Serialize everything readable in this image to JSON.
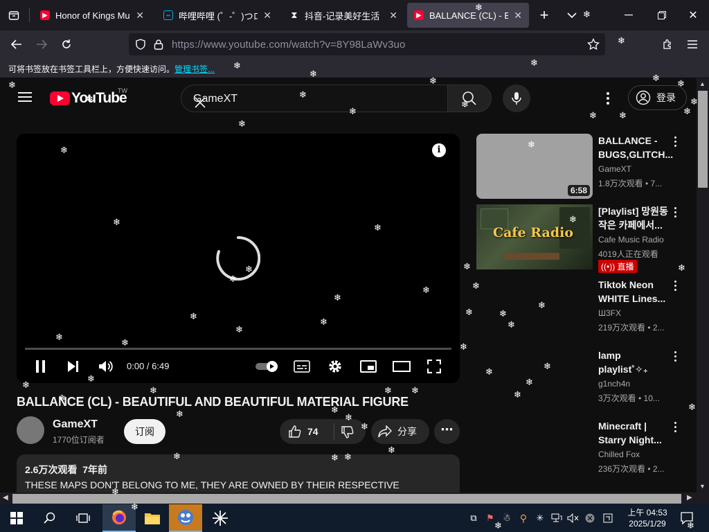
{
  "browser": {
    "tabs": [
      {
        "title": "Honor of Kings Musa",
        "favicon": "youtube-icon",
        "active": false
      },
      {
        "title": "哔哩哔哩 (゜-゜)つロ",
        "favicon": "bilibili-icon",
        "active": false
      },
      {
        "title": "抖音-记录美好生活",
        "favicon": "douyin-icon",
        "active": false
      },
      {
        "title": "BALLANCE (CL) - BEA",
        "favicon": "youtube-icon",
        "active": true
      }
    ],
    "url": "https://www.youtube.com/watch?v=8Y98LaWv3uo",
    "bookmark_hint": "可将书签放在书签工具栏上，方便快速访问。",
    "bookmark_link": "管理书签..."
  },
  "youtube": {
    "logo_text": "YouTube",
    "country_code": "TW",
    "search_value": "GameXT",
    "login_label": "登录",
    "player": {
      "time": "0:00 / 6:49",
      "progress": 0
    },
    "video": {
      "title": "BALLANCE (CL) - BEAUTIFUL AND BEAUTIFUL MATERIAL FIGURE",
      "channel": "GameXT",
      "subscribers": "1770位订阅者",
      "subscribe_label": "订阅",
      "likes": "74",
      "share_label": "分享",
      "views": "2.6万次观看",
      "age": "7年前",
      "description": "THESE MAPS DON'T BELONG TO ME, THEY ARE OWNED BY THEIR RESPECTIVE CREATORS."
    },
    "recommendations": [
      {
        "title1": "BALLANCE -",
        "title2": "BUGS,GLITCH...",
        "channel": "GameXT",
        "meta": "1.8万次观看 • 7...",
        "duration": "6:58"
      },
      {
        "title1": "[Playlist] 망원동",
        "title2": "작은 카페에서...",
        "channel": "Cafe Music Radio",
        "meta": "4019人正在观看",
        "live": "直播",
        "thumb_text": "Cafe Radio"
      },
      {
        "title1": "Tiktok Neon",
        "title2": "WHITE Lines...",
        "channel": "Ш3FX",
        "meta": "219万次观看 • 2..."
      },
      {
        "title1": "lamp",
        "title2": "playlist˚✧₊",
        "channel": "g1nch4n",
        "meta": "3万次观看 • 10..."
      },
      {
        "title1": "Minecraft |",
        "title2": "Starry Night...",
        "channel": "Chilled Fox",
        "meta": "236万次观看 • 2..."
      }
    ]
  },
  "taskbar": {
    "time": "上午 04:53",
    "date": "2025/1/29"
  },
  "colors": {
    "youtube_red": "#ff0033",
    "live_red": "#cc0000",
    "link": "#00ddff"
  }
}
